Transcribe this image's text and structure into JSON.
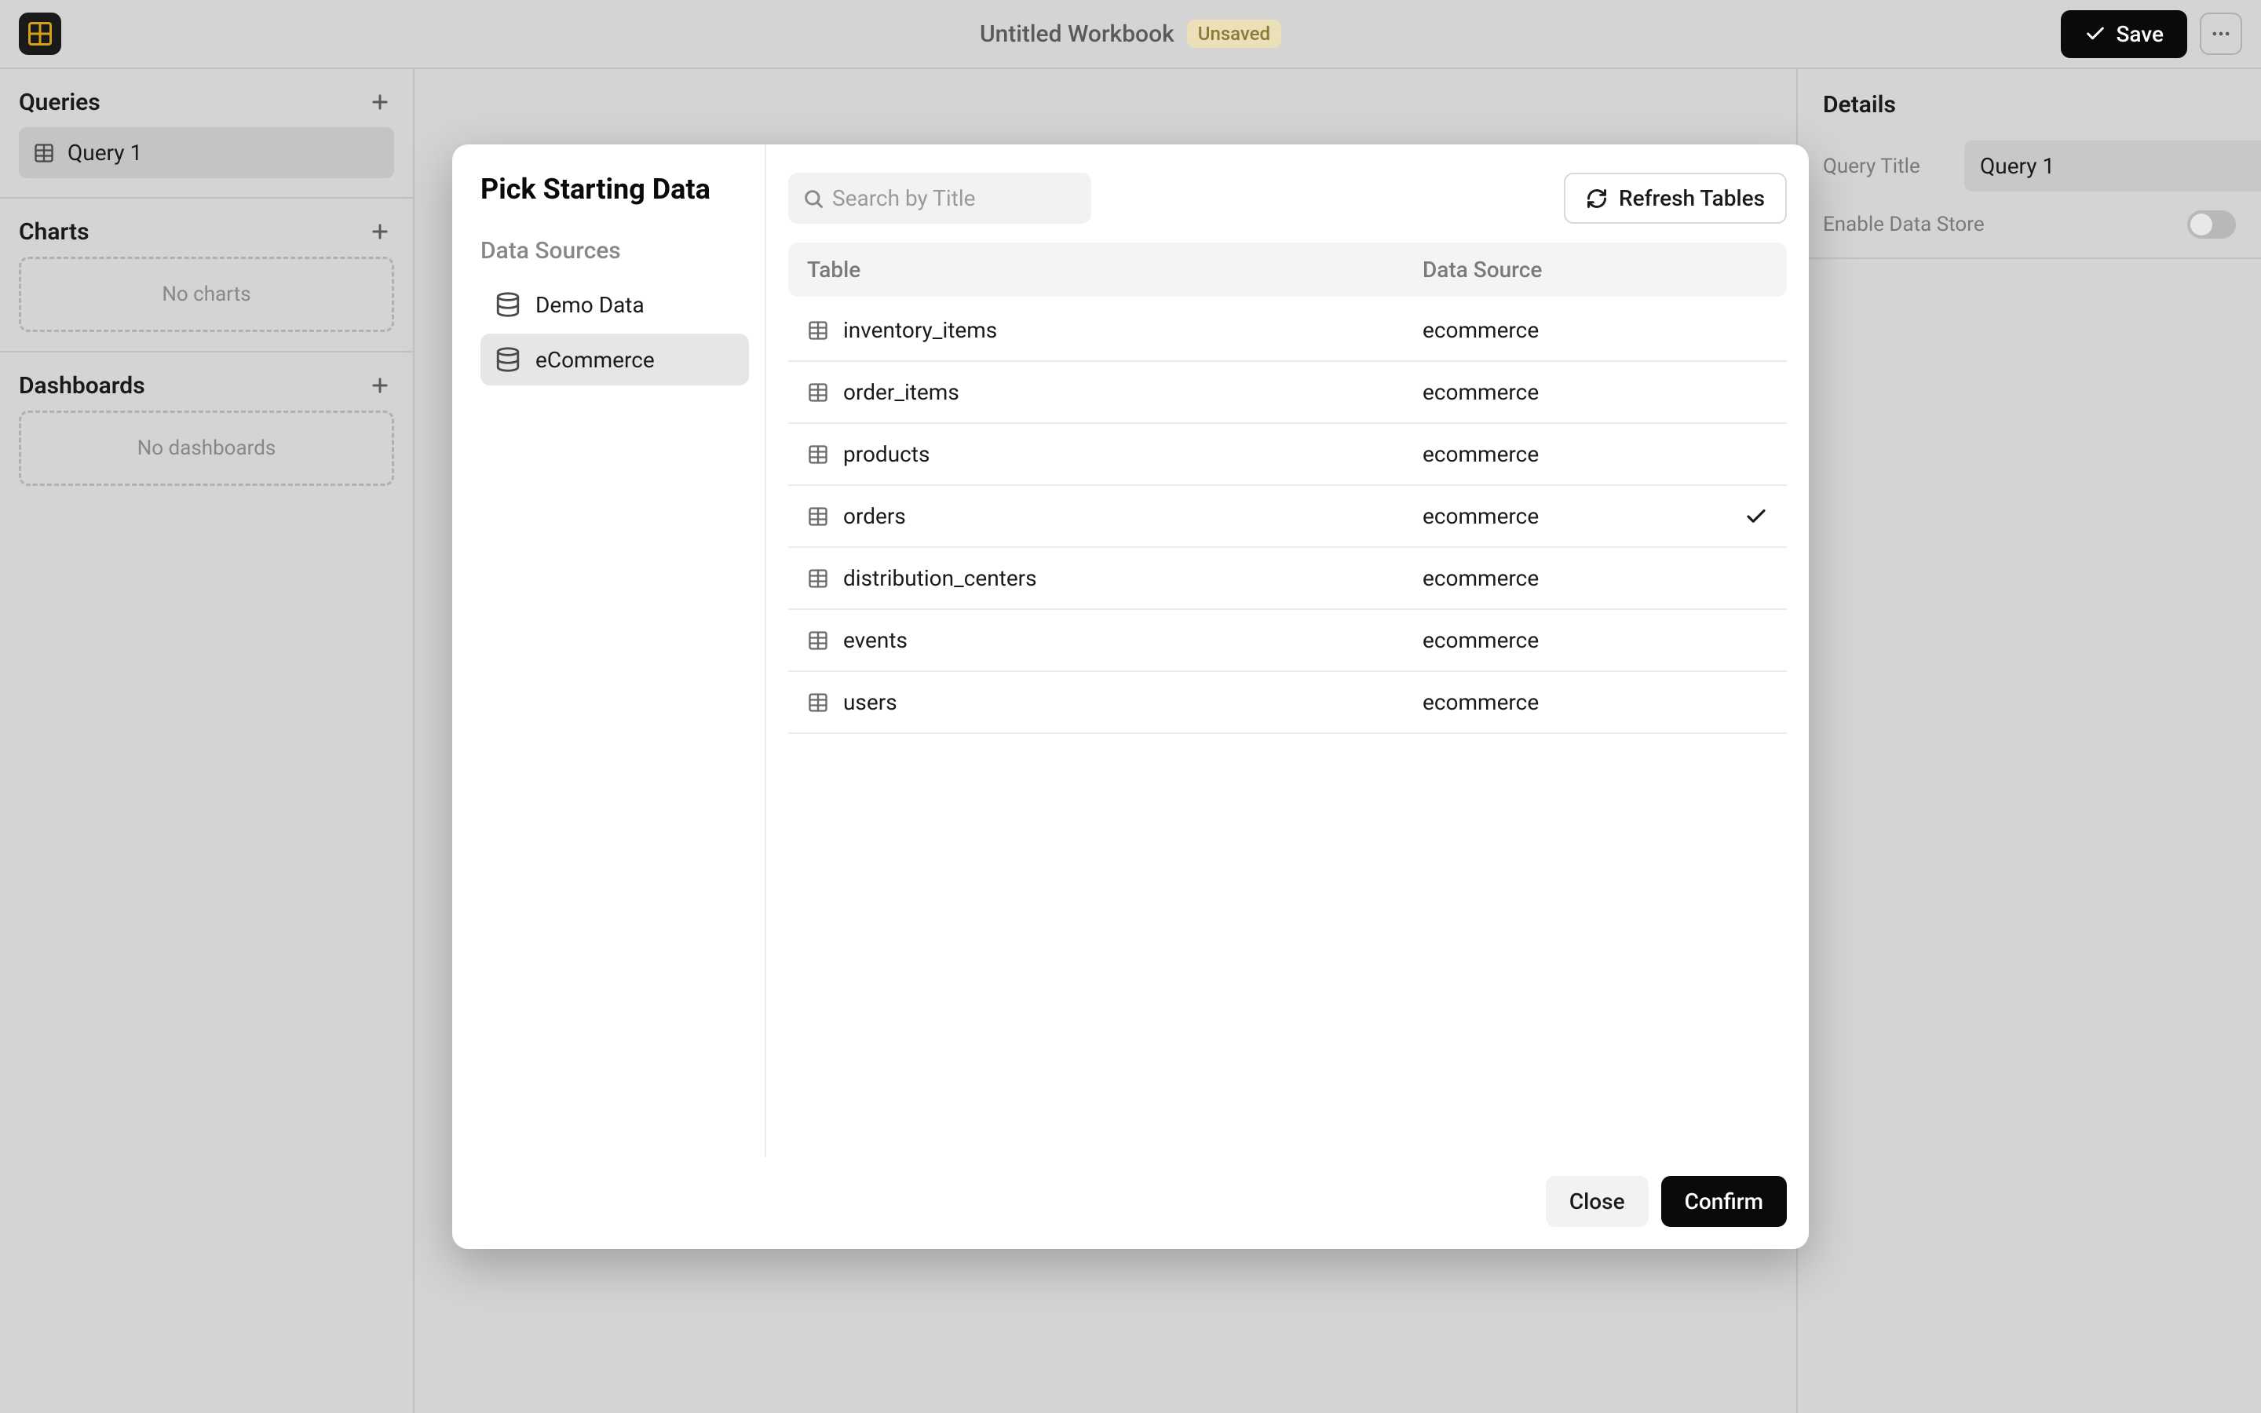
{
  "topbar": {
    "workbook_title": "Untitled Workbook",
    "unsaved_label": "Unsaved",
    "save_label": "Save"
  },
  "sidebar": {
    "queries_title": "Queries",
    "query_items": [
      {
        "label": "Query 1"
      }
    ],
    "charts_title": "Charts",
    "no_charts": "No charts",
    "dashboards_title": "Dashboards",
    "no_dashboards": "No dashboards"
  },
  "details": {
    "heading": "Details",
    "query_title_label": "Query Title",
    "query_title_value": "Query 1",
    "enable_data_store_label": "Enable Data Store",
    "enable_data_store_value": false
  },
  "modal": {
    "title": "Pick Starting Data",
    "data_sources_label": "Data Sources",
    "data_sources": [
      {
        "label": "Demo Data",
        "active": false
      },
      {
        "label": "eCommerce",
        "active": true
      }
    ],
    "search_placeholder": "Search by Title",
    "refresh_label": "Refresh Tables",
    "columns": {
      "table": "Table",
      "source": "Data Source"
    },
    "tables": [
      {
        "name": "inventory_items",
        "source": "ecommerce",
        "selected": false
      },
      {
        "name": "order_items",
        "source": "ecommerce",
        "selected": false
      },
      {
        "name": "products",
        "source": "ecommerce",
        "selected": false
      },
      {
        "name": "orders",
        "source": "ecommerce",
        "selected": true
      },
      {
        "name": "distribution_centers",
        "source": "ecommerce",
        "selected": false
      },
      {
        "name": "events",
        "source": "ecommerce",
        "selected": false
      },
      {
        "name": "users",
        "source": "ecommerce",
        "selected": false
      }
    ],
    "close_label": "Close",
    "confirm_label": "Confirm"
  }
}
